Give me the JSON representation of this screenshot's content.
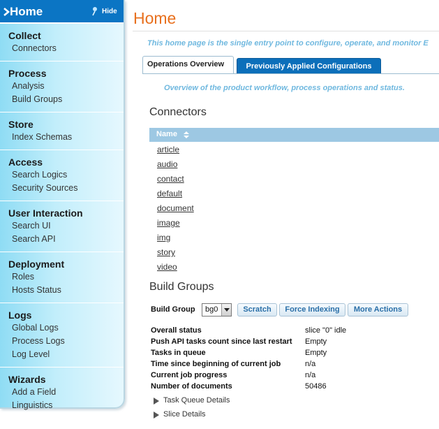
{
  "sidebar": {
    "title": "Home",
    "hide_label": "Hide",
    "sections": [
      {
        "title": "Collect",
        "items": [
          "Connectors"
        ]
      },
      {
        "title": "Process",
        "items": [
          "Analysis",
          "Build Groups"
        ]
      },
      {
        "title": "Store",
        "items": [
          "Index Schemas"
        ]
      },
      {
        "title": "Access",
        "items": [
          "Search Logics",
          "Security Sources"
        ]
      },
      {
        "title": "User Interaction",
        "items": [
          "Search UI",
          "Search API"
        ]
      },
      {
        "title": "Deployment",
        "items": [
          "Roles",
          "Hosts Status"
        ]
      },
      {
        "title": "Logs",
        "items": [
          "Global Logs",
          "Process Logs",
          "Log Level"
        ]
      },
      {
        "title": "Wizards",
        "items": [
          "Add a Field",
          "Linguistics"
        ]
      }
    ]
  },
  "main": {
    "title": "Home",
    "subtitle": "This home page is the single entry point to configure, operate, and monitor E",
    "tabs": [
      {
        "label": "Operations Overview"
      },
      {
        "label": "Previously Applied Configurations"
      }
    ],
    "tab_description": "Overview of the product workflow, process operations and status.",
    "connectors": {
      "heading": "Connectors",
      "column_name": "Name",
      "rows": [
        "article",
        "audio",
        "contact",
        "default",
        "document",
        "image",
        "img",
        "story",
        "video"
      ]
    },
    "build_groups": {
      "heading": "Build Groups",
      "label": "Build Group",
      "selected": "bg0",
      "buttons": [
        "Scratch",
        "Force Indexing",
        "More Actions"
      ],
      "status": [
        {
          "key": "Overall status",
          "value": "slice \"0\" idle"
        },
        {
          "key": "Push API tasks count since last restart",
          "value": "Empty"
        },
        {
          "key": "Tasks in queue",
          "value": "Empty"
        },
        {
          "key": "Time since beginning of current job",
          "value": "n/a"
        },
        {
          "key": "Current job progress",
          "value": "n/a"
        },
        {
          "key": "Number of documents",
          "value": "50486"
        }
      ],
      "expanders": [
        "Task Queue Details",
        "Slice Details"
      ]
    }
  },
  "colors": {
    "accent_orange": "#e8701e",
    "header_blue": "#0b75c4",
    "table_header": "#9dc8e3",
    "hint_text": "#6fb8df"
  }
}
